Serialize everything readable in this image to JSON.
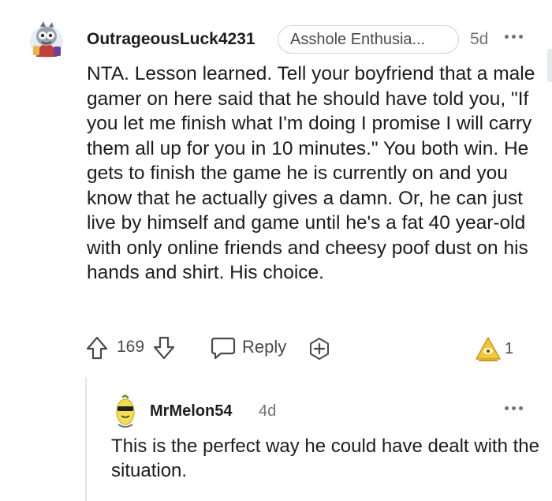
{
  "comment": {
    "username": "OutrageousLuck4231",
    "flair": "Asshole Enthusia...",
    "time": "5d",
    "body": "NTA. Lesson learned. Tell your boyfriend that a male gamer on here said that he should have told you, \"If you let me finish what I'm doing I promise I will carry them all up for you in 10 minutes.\" You both win. He gets to finish the game he is currently on and you know that he actually gives a damn. Or, he can just live by himself and game until he's a fat 40 year-old with only online friends and cheesy poof dust on his hands and shirt. His choice.",
    "votes": "169",
    "reply_label": "Reply",
    "award_count": "1"
  },
  "reply": {
    "username": "MrMelon54",
    "time": "4d",
    "body": "This is the perfect way he could have dealt with the situation."
  },
  "icons": {
    "upvote": "upvote-arrow-icon",
    "downvote": "downvote-arrow-icon",
    "reply": "speech-bubble-icon",
    "award": "plus-award-icon",
    "award_badge": "gold-award-icon",
    "more": "more-options-icon"
  },
  "colors": {
    "text": "#1c1c1c",
    "meta": "#6f7377",
    "icon": "#4a4a4a",
    "award_gold": "#f2c83a"
  }
}
